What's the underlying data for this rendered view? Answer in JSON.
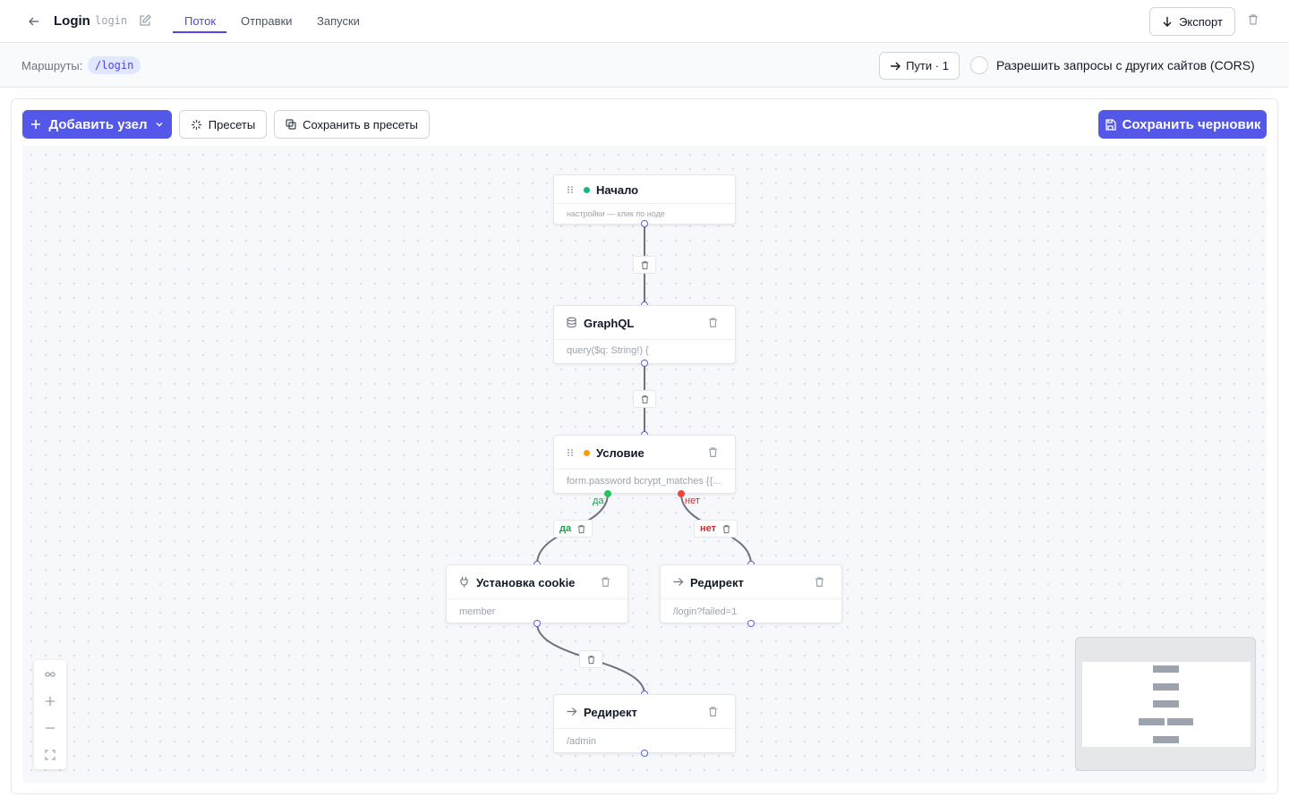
{
  "header": {
    "title": "Login",
    "slug": "login",
    "tabs": {
      "flow": "Поток",
      "sends": "Отправки",
      "runs": "Запуски"
    },
    "active_tab": "flow",
    "export_label": "Экспорт"
  },
  "routes": {
    "label": "Маршруты:",
    "chip": "/login",
    "paths_label": "Пути · 1",
    "cors_label": "Разрешить запросы с других сайтов (CORS)",
    "cors_enabled": false
  },
  "toolbar": {
    "add_node": "Добавить узел",
    "presets": "Пресеты",
    "save_preset": "Сохранить в пресеты",
    "save_draft": "Сохранить черновик"
  },
  "nodes": {
    "start": {
      "title": "Начало",
      "subtitle": "настройки — клик по ноде",
      "status_color": "#10b981"
    },
    "graphql": {
      "title": "GraphQL",
      "subtitle": "query($q: String!) {",
      "icon": "database-icon"
    },
    "condition": {
      "title": "Условие",
      "subtitle": "form.password bcrypt_matches {{...",
      "status_color": "#f59e0b"
    },
    "cookie": {
      "title": "Установка cookie",
      "subtitle": "member",
      "icon": "plug-icon"
    },
    "redirect_fail": {
      "title": "Редирект",
      "subtitle": "/login?failed=1",
      "icon": "arrow-right-icon"
    },
    "redirect_admin": {
      "title": "Редирект",
      "subtitle": "/admin",
      "icon": "arrow-right-icon"
    }
  },
  "branches": {
    "yes": "да",
    "no": "нет"
  },
  "colors": {
    "accent": "#5458e8",
    "yes": "#16a34a",
    "no": "#dc2626",
    "edge": "#6b7280"
  }
}
